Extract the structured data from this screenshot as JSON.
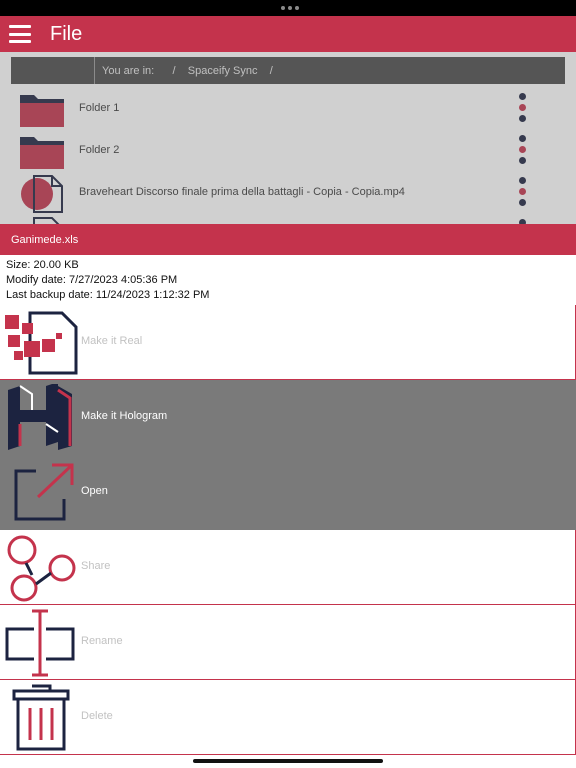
{
  "app": {
    "title": "File"
  },
  "breadcrumb": {
    "text": "You are in:      /    Spaceify Sync    /"
  },
  "files": [
    {
      "name": "Folder 1",
      "icon": "folder-icon"
    },
    {
      "name": "Folder 2",
      "icon": "folder-icon"
    },
    {
      "name": "Braveheart Discorso finale prima della battagli - Copia - Copia.mp4",
      "icon": "video-file-icon"
    },
    {
      "name": "",
      "icon": "file-icon"
    }
  ],
  "sheet": {
    "file_name": "Ganimede.xls",
    "size": "Size: 20.00 KB",
    "modify_date": "Modify date: 7/27/2023 4:05:36 PM",
    "backup_date": "Last backup date: 11/24/2023 1:12:32 PM"
  },
  "actions": [
    {
      "label": "Make it Real",
      "icon": "make-real-icon",
      "enabled": false
    },
    {
      "label": "Make it Hologram",
      "icon": "hologram-icon",
      "enabled": true
    },
    {
      "label": "Open",
      "icon": "open-external-icon",
      "enabled": true
    },
    {
      "label": "Share",
      "icon": "share-icon",
      "enabled": false
    },
    {
      "label": "Rename",
      "icon": "rename-icon",
      "enabled": false
    },
    {
      "label": "Delete",
      "icon": "trash-icon",
      "enabled": false
    }
  ],
  "colors": {
    "accent": "#c4334c",
    "navy": "#1c2340",
    "disabled_bg": "#7a7a7a"
  }
}
